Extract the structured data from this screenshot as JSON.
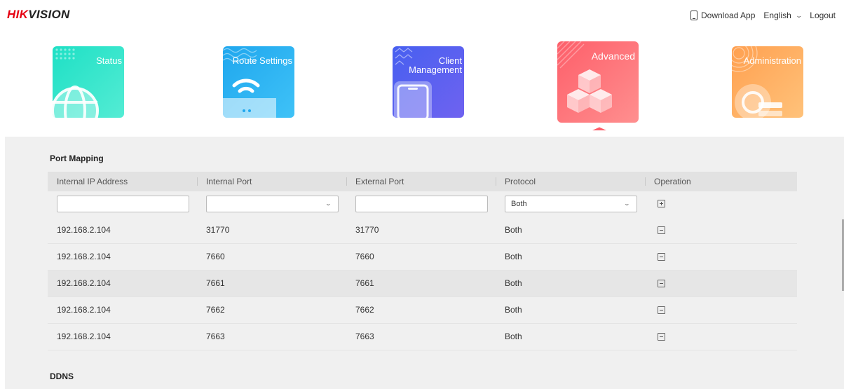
{
  "brand": {
    "logo_part1": "HIK",
    "logo_part2": "VISION"
  },
  "topbar": {
    "download_app": "Download App",
    "language": "English",
    "logout": "Logout"
  },
  "nav": {
    "tiles": [
      {
        "label": "Status",
        "colors": [
          "#1ee0c5",
          "#54ecd4"
        ]
      },
      {
        "label": "Route Settings",
        "colors": [
          "#1fa7ee",
          "#3fc2f7"
        ]
      },
      {
        "label": "Client Management",
        "colors": [
          "#4760f0",
          "#6f62f0"
        ]
      },
      {
        "label": "Advanced",
        "colors": [
          "#fd5f6a",
          "#ff8f8f"
        ]
      },
      {
        "label": "Administration",
        "colors": [
          "#ffa050",
          "#ffc27a"
        ]
      }
    ],
    "active": "Advanced"
  },
  "port_mapping": {
    "title": "Port Mapping",
    "columns": [
      "Internal IP Address",
      "Internal Port",
      "External Port",
      "Protocol",
      "Operation"
    ],
    "new_entry": {
      "internal_ip": "",
      "internal_port": "",
      "external_port": "",
      "protocol": "Both",
      "add_icon": "plus-square-icon"
    },
    "rows": [
      {
        "ip": "192.168.2.104",
        "internal_port": "31770",
        "external_port": "31770",
        "protocol": "Both"
      },
      {
        "ip": "192.168.2.104",
        "internal_port": "7660",
        "external_port": "7660",
        "protocol": "Both"
      },
      {
        "ip": "192.168.2.104",
        "internal_port": "7661",
        "external_port": "7661",
        "protocol": "Both"
      },
      {
        "ip": "192.168.2.104",
        "internal_port": "7662",
        "external_port": "7662",
        "protocol": "Both"
      },
      {
        "ip": "192.168.2.104",
        "internal_port": "7663",
        "external_port": "7663",
        "protocol": "Both"
      }
    ],
    "delete_icon": "minus-square-icon"
  },
  "ddns": {
    "title": "DDNS"
  }
}
